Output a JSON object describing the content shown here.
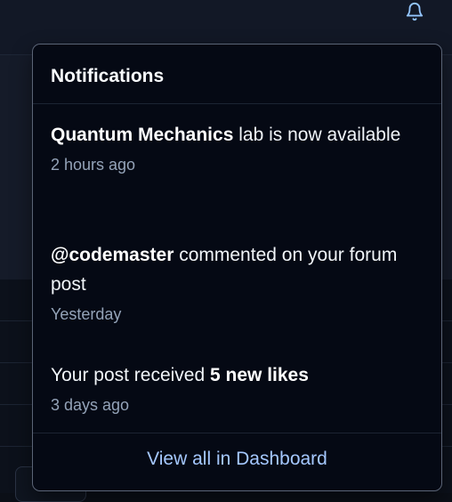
{
  "colors": {
    "panel_background": "#050914",
    "page_background": "#0b0f17",
    "text_primary": "#f1f5f9",
    "text_muted": "#94a3b8",
    "link": "#a5c8ff",
    "bell_icon": "#93c5fd"
  },
  "header": {
    "bell_icon": "bell-icon"
  },
  "notifications": {
    "title": "Notifications",
    "items": [
      {
        "strong": "Quantum Mechanics",
        "text_after": " lab is now available",
        "time": "2 hours ago"
      },
      {
        "strong": "@codemaster",
        "text_after": " commented on your forum post",
        "time": "Yesterday"
      },
      {
        "text_before": "Your post received ",
        "strong": "5 new likes",
        "time": "3 days ago"
      }
    ],
    "footer_link": "View all in Dashboard"
  }
}
